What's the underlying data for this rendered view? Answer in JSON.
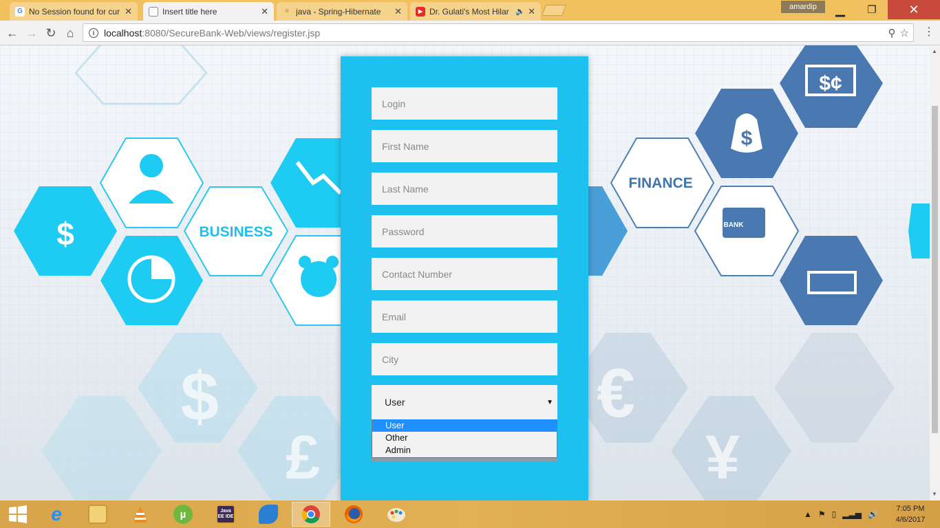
{
  "browser": {
    "tabs": [
      {
        "title": "No Session found for cur",
        "icon": "google-icon",
        "active": false
      },
      {
        "title": "Insert title here",
        "icon": "document-icon",
        "active": true
      },
      {
        "title": "java - Spring-Hibernate",
        "icon": "stackoverflow-icon",
        "active": false
      },
      {
        "title": "Dr. Gulati's Most Hilar",
        "icon": "youtube-icon",
        "active": false
      }
    ],
    "profile_name": "amardip",
    "url_host": "localhost",
    "url_path": ":8080/SecureBank-Web/views/register.jsp"
  },
  "background": {
    "business_label": "BUSINESS",
    "finance_label": "FINANCE",
    "bank_label": "BANK"
  },
  "form": {
    "login_placeholder": "Login",
    "first_name_placeholder": "First Name",
    "last_name_placeholder": "Last Name",
    "password_placeholder": "Password",
    "contact_placeholder": "Contact Number",
    "email_placeholder": "Email",
    "city_placeholder": "City",
    "role_selected": "User",
    "role_options": [
      "User",
      "Other",
      "Admin"
    ]
  },
  "taskbar": {
    "apps": [
      "start-icon",
      "internet-explorer-icon",
      "file-explorer-icon",
      "vlc-icon",
      "utorrent-icon",
      "java-ee-ide-icon",
      "dolphin-icon",
      "chrome-icon",
      "firefox-icon",
      "paint-icon"
    ],
    "java_ide_label": "Java EE IDE",
    "clock_time": "7:05 PM",
    "clock_date": "4/6/2017"
  },
  "colors": {
    "form_panel": "#1ec0f0",
    "chrome_frame": "#f2c15f",
    "taskbar": "#e2b055",
    "hex_cyan": "#1ecbf2",
    "hex_blue": "#4a78b0",
    "dropdown_highlight": "#1e90ff"
  }
}
